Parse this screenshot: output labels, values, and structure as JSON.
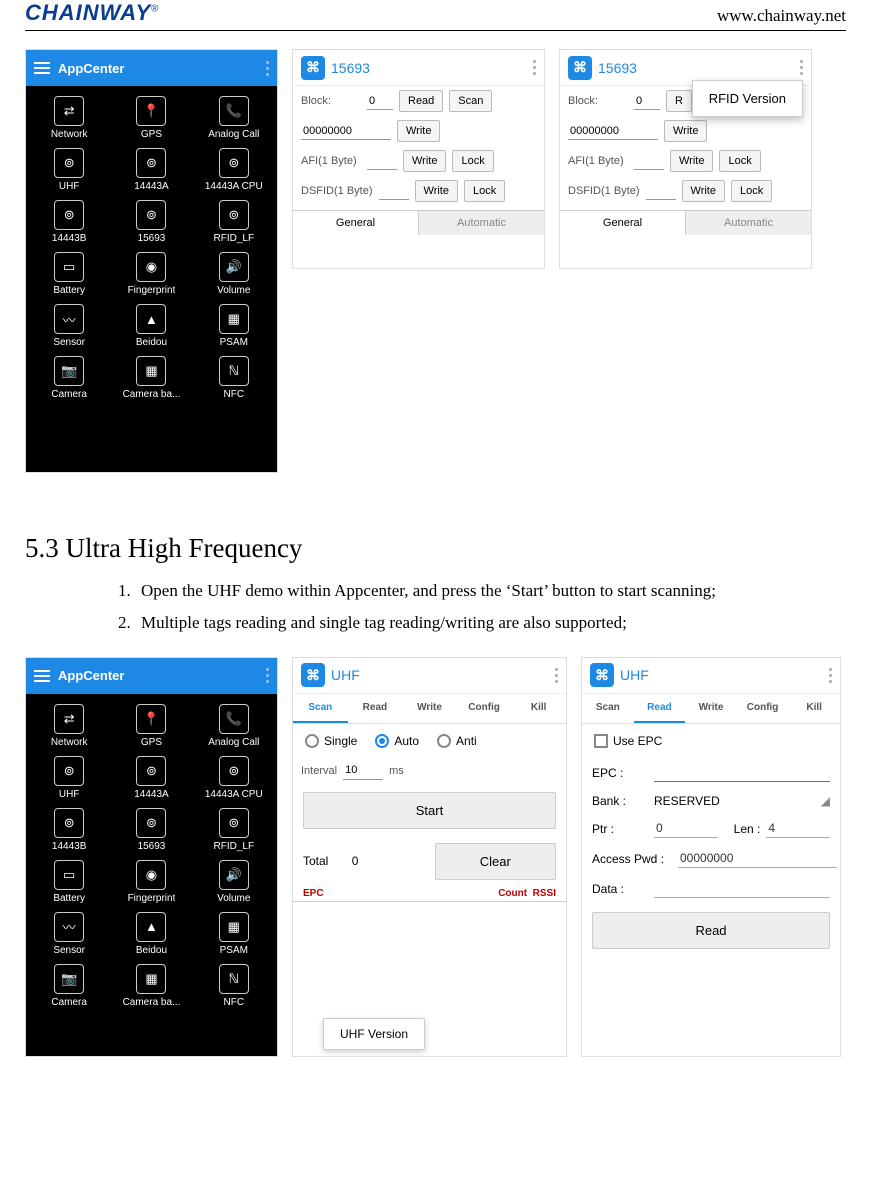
{
  "header": {
    "logo_text": "CHAINWAY",
    "url": "www.chainway.net"
  },
  "appcenter": {
    "title": "AppCenter",
    "items": [
      [
        "Network",
        "GPS",
        "Analog Call"
      ],
      [
        "UHF",
        "14443A",
        "14443A CPU"
      ],
      [
        "14443B",
        "15693",
        "RFID_LF"
      ],
      [
        "Battery",
        "Fingerprint",
        "Volume"
      ],
      [
        "Sensor",
        "Beidou",
        "PSAM"
      ],
      [
        "Camera",
        "Camera ba...",
        "NFC"
      ]
    ],
    "icons": [
      [
        "⇄",
        "📍",
        "📞"
      ],
      [
        "⊚",
        "⊚",
        "⊚"
      ],
      [
        "⊚",
        "⊚",
        "⊚"
      ],
      [
        "▭",
        "◉",
        "🔊"
      ],
      [
        "〰",
        "▲",
        "▦"
      ],
      [
        "📷",
        "▦",
        "ℕ"
      ]
    ]
  },
  "i15693": {
    "title": "15693",
    "block_label": "Block:",
    "block_value": "0",
    "read": "Read",
    "scan": "Scan",
    "data_value": "00000000",
    "write": "Write",
    "lock": "Lock",
    "afi_label": "AFI(1 Byte)",
    "dsfid_label": "DSFID(1 Byte)",
    "tab_general": "General",
    "tab_auto": "Automatic",
    "popup_rfid": "RFID Version"
  },
  "section53": {
    "heading": "5.3    Ultra High Frequency",
    "items": [
      "Open the UHF demo within Appcenter, and press the ‘Start’ button to start scanning;",
      "Multiple tags reading and single tag reading/writing are also supported;"
    ]
  },
  "uhf": {
    "title": "UHF",
    "tabs": [
      "Scan",
      "Read",
      "Write",
      "Config",
      "Kill"
    ],
    "single": "Single",
    "auto": "Auto",
    "anti": "Anti",
    "interval_label": "Interval",
    "interval_value": "10",
    "interval_unit": "ms",
    "start": "Start",
    "clear": "Clear",
    "total_label": "Total",
    "total_value": "0",
    "col_epc": "EPC",
    "col_count": "Count",
    "col_rssi": "RSSI",
    "menu_uhf_ver": "UHF Version",
    "use_epc": "Use EPC",
    "epc_label": "EPC :",
    "bank_label": "Bank :",
    "bank_value": "RESERVED",
    "ptr_label": "Ptr :",
    "ptr_value": "0",
    "len_label": "Len :",
    "len_value": "4",
    "pwd_label": "Access Pwd :",
    "pwd_value": "00000000",
    "data_label": "Data :",
    "read_btn": "Read"
  }
}
